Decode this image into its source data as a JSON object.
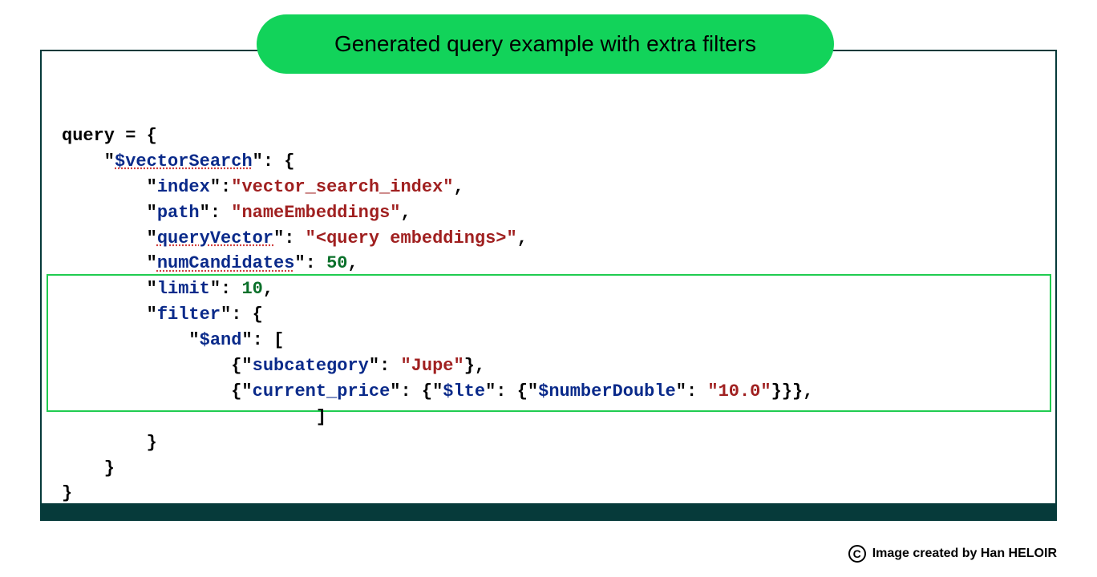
{
  "header": {
    "title": "Generated query example with extra filters"
  },
  "code": {
    "line1_prefix": "query = {",
    "vectorSearch_key": "$vectorSearch",
    "index_key": "index",
    "index_val": "vector_search_index",
    "path_key": "path",
    "path_val": "nameEmbeddings",
    "queryVector_key": "queryVector",
    "queryVector_val": "<query embeddings>",
    "numCandidates_key": "numCandidates",
    "numCandidates_val": "50",
    "limit_key": "limit",
    "limit_val": "10",
    "filter_key": "filter",
    "and_key": "$and",
    "subcategory_key": "subcategory",
    "subcategory_val": "Jupe",
    "current_price_key": "current_price",
    "lte_key": "$lte",
    "numberDouble_key": "$numberDouble",
    "numberDouble_val": "10.0"
  },
  "credit": {
    "text": "Image created by Han HELOIR",
    "symbol": "C"
  }
}
